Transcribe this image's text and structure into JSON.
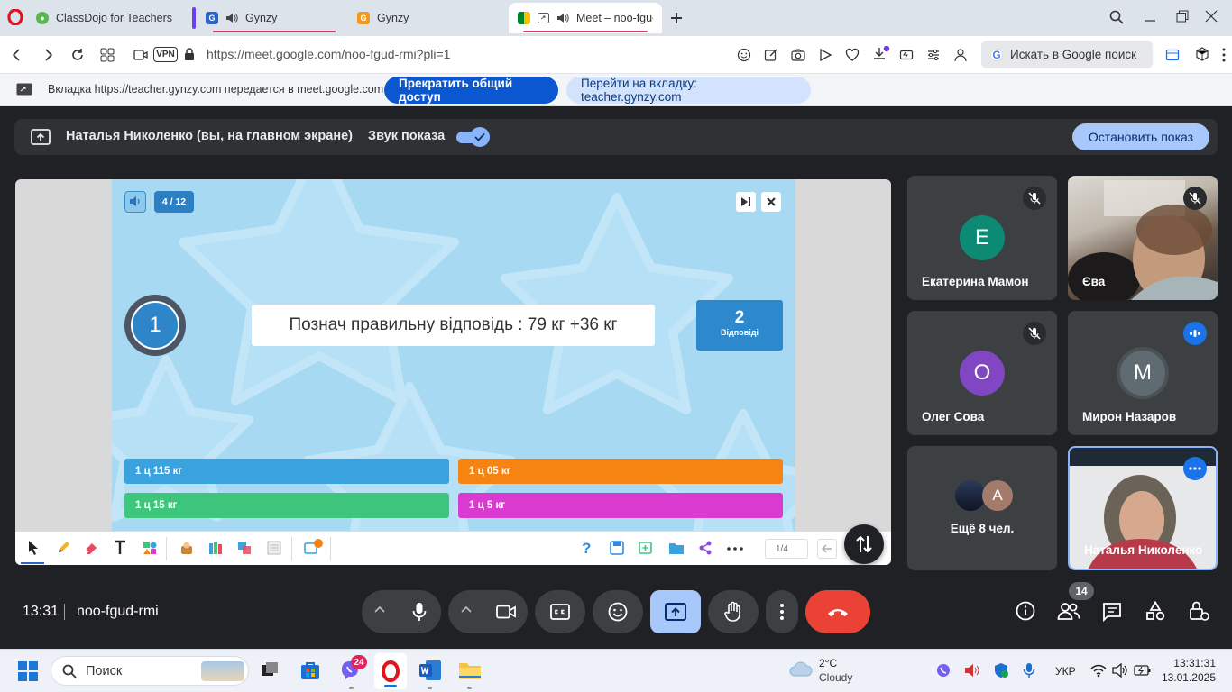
{
  "browser": {
    "tabs": [
      {
        "title": "ClassDojo for Teachers"
      },
      {
        "title": "Gynzy"
      },
      {
        "title": "Gynzy"
      },
      {
        "title": "Meet – noo-fgud-rmi"
      }
    ],
    "url": "https://meet.google.com/noo-fgud-rmi?pli=1",
    "vpn_label": "VPN",
    "search_placeholder": "Искать в Google поиск"
  },
  "share_bar": {
    "message": "Вкладка https://teacher.gynzy.com передается в meet.google.com",
    "stop_button": "Прекратить общий доступ",
    "switch_button": "Перейти на вкладку: teacher.gynzy.com"
  },
  "presenting": {
    "presenter": "Наталья Николенко (вы, на главном экране)",
    "audio_label": "Звук показа",
    "stop_label": "Остановить показ"
  },
  "slide": {
    "progress": "4 / 12",
    "number": "1",
    "question": "Познач правильну відповідь : 79 кг +36 кг",
    "answers_count": "2",
    "answers_label": "Відповіді",
    "answers": [
      "1 ц 115 кг",
      "1 ц 05 кг",
      "1 ц 15 кг",
      "1 ц 5 кг"
    ],
    "page": "1/4"
  },
  "participants": [
    {
      "name": "Екатерина Мамон",
      "initial": "Е",
      "color": "#0d8a73"
    },
    {
      "name": "Єва"
    },
    {
      "name": "Олег Сова",
      "initial": "О",
      "color": "#8146c2"
    },
    {
      "name": "Мирон Назаров",
      "initial": "М",
      "color": "#5f6b70"
    },
    {
      "name": "Ещё 8 чел.",
      "initial": "А",
      "color": "#a47b6b"
    },
    {
      "name": "Наталья Николенко"
    }
  ],
  "meeting": {
    "time": "13:31",
    "code": "noo-fgud-rmi",
    "people_count": "14"
  },
  "taskbar": {
    "search": "Поиск",
    "viber_badge": "24",
    "weather_temp": "2°C",
    "weather_desc": "Cloudy",
    "language": "УКР",
    "clock_time": "13:31:31",
    "clock_date": "13.01.2025"
  }
}
